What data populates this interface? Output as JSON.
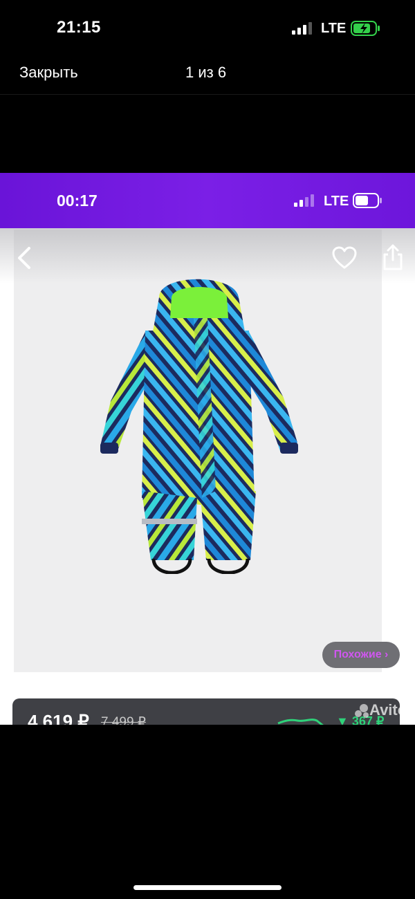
{
  "status_bar": {
    "time": "21:15",
    "network": "LTE"
  },
  "viewer": {
    "close_label": "Закрыть",
    "counter": "1 из 6"
  },
  "inner_screenshot": {
    "status_bar": {
      "time": "00:17",
      "network": "LTE"
    },
    "similar_button": "Похожие ›",
    "price": {
      "current": "4 619 ₽",
      "old": "7 499 ₽",
      "delta": "▼ 367 ₽"
    },
    "watermark": "Avito",
    "colors": {
      "header_purple": "#7b1fe6",
      "accent_pink": "#d056f0",
      "delta_green": "#2fd27a"
    },
    "icons": [
      "back-chevron-icon",
      "heart-icon",
      "share-icon"
    ]
  }
}
